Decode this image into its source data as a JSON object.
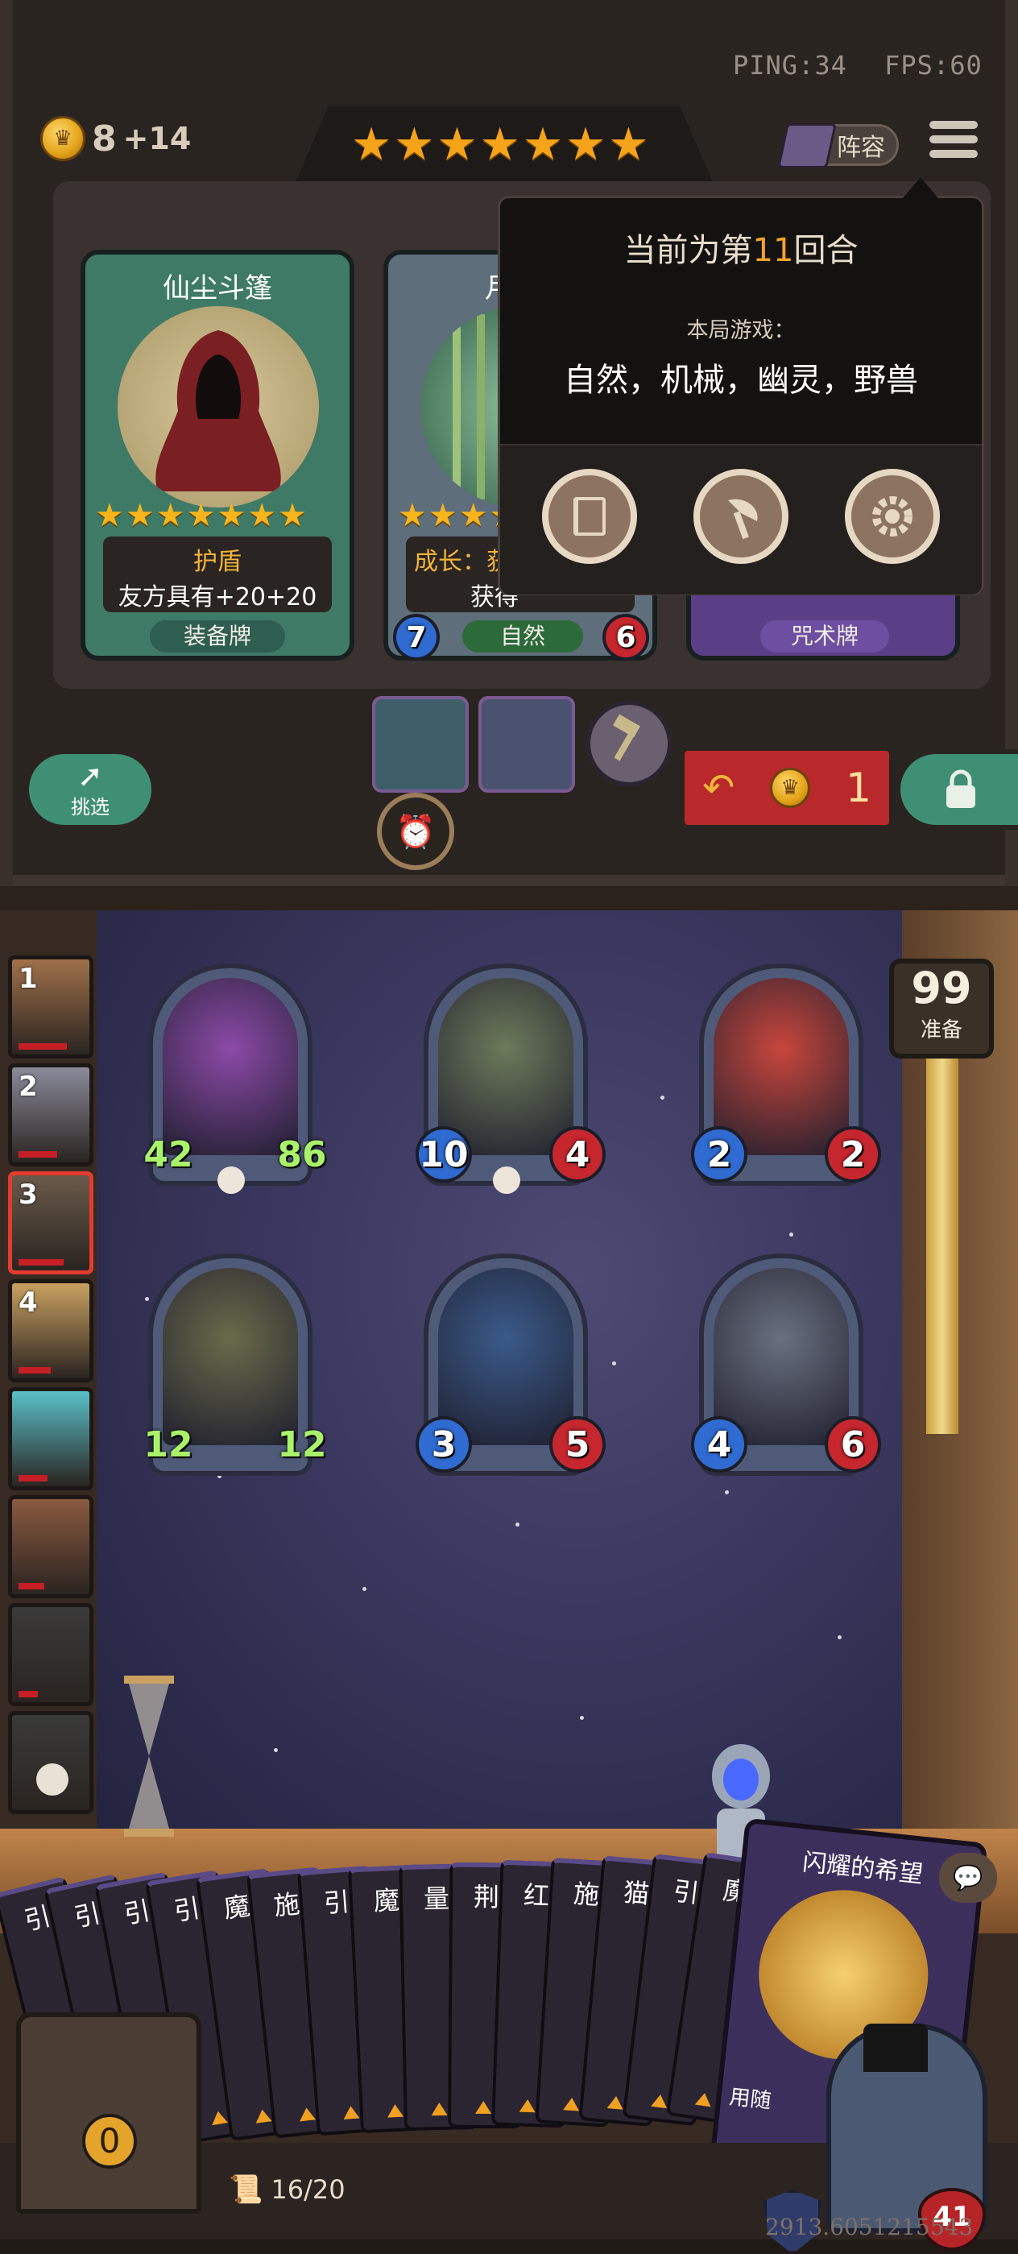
{
  "hud": {
    "ping": "PING:34",
    "fps": "FPS:60"
  },
  "gold": {
    "amount": "8",
    "income": "+14"
  },
  "tier_stars": 7,
  "lineup_button": "阵容",
  "shop_cards": [
    {
      "title": "仙尘斗篷",
      "stars": 7,
      "keyword": "护盾",
      "desc": "友方具有+20+20",
      "tag": "装备牌",
      "theme": "#3f7a66"
    },
    {
      "title": "月",
      "stars": 7,
      "keyword": "成长：获",
      "desc": "获得",
      "tag": "自然",
      "atk": "7",
      "hp": "6",
      "theme": "#5e6e7a"
    },
    {
      "title": "",
      "stars": 7,
      "keyword": "",
      "desc": "",
      "tag": "咒术牌",
      "theme": "#5b3f86"
    }
  ],
  "popup": {
    "round_prefix": "当前为第",
    "round_number": "11",
    "round_suffix": "回合",
    "game_label": "本局游戏：",
    "tribes": "自然，机械，幽灵，野兽",
    "buttons": [
      "book-icon",
      "axe-icon",
      "gear-icon"
    ]
  },
  "shop_controls": {
    "pick_label": "挑选",
    "refresh_cost": "1"
  },
  "prep": {
    "count": "99",
    "label": "准备"
  },
  "ranking": [
    {
      "rank": "1",
      "hp": 0.75
    },
    {
      "rank": "2",
      "hp": 0.6
    },
    {
      "rank": "3",
      "hp": 0.7,
      "selected": true
    },
    {
      "rank": "4",
      "hp": 0.5
    },
    {
      "rank": "",
      "hp": 0.45
    },
    {
      "rank": "",
      "hp": 0.4
    },
    {
      "rank": "",
      "hp": 0.3
    },
    {
      "rank": "",
      "hp": 0.0,
      "dead": true
    }
  ],
  "board_units": [
    {
      "name": "plant",
      "atk": "42",
      "hp": "86",
      "big": true,
      "skull": true,
      "color": "#8c4aa8"
    },
    {
      "name": "witch",
      "atk": "10",
      "hp": "4",
      "skull": true,
      "color": "#6d7a5a"
    },
    {
      "name": "grin",
      "atk": "2",
      "hp": "2",
      "color": "#c8463c"
    },
    {
      "name": "mushroom-spider",
      "atk": "12",
      "hp": "12",
      "big": true,
      "color": "#6a6a4a"
    },
    {
      "name": "imp",
      "atk": "3",
      "hp": "5",
      "color": "#3a5a8a"
    },
    {
      "name": "knight",
      "atk": "4",
      "hp": "6",
      "color": "#6a7080"
    }
  ],
  "hand": {
    "card_labels": [
      "引",
      "引",
      "引",
      "引",
      "魔",
      "施",
      "引",
      "魔",
      "量",
      "荆",
      "红",
      "施",
      "猫",
      "引",
      "魔"
    ],
    "featured_card": "闪耀的希望",
    "featured_text": "用随",
    "deck": "16/20",
    "chest_count": "0",
    "player_hp": "41"
  },
  "debug_text": "2913.6051215543"
}
